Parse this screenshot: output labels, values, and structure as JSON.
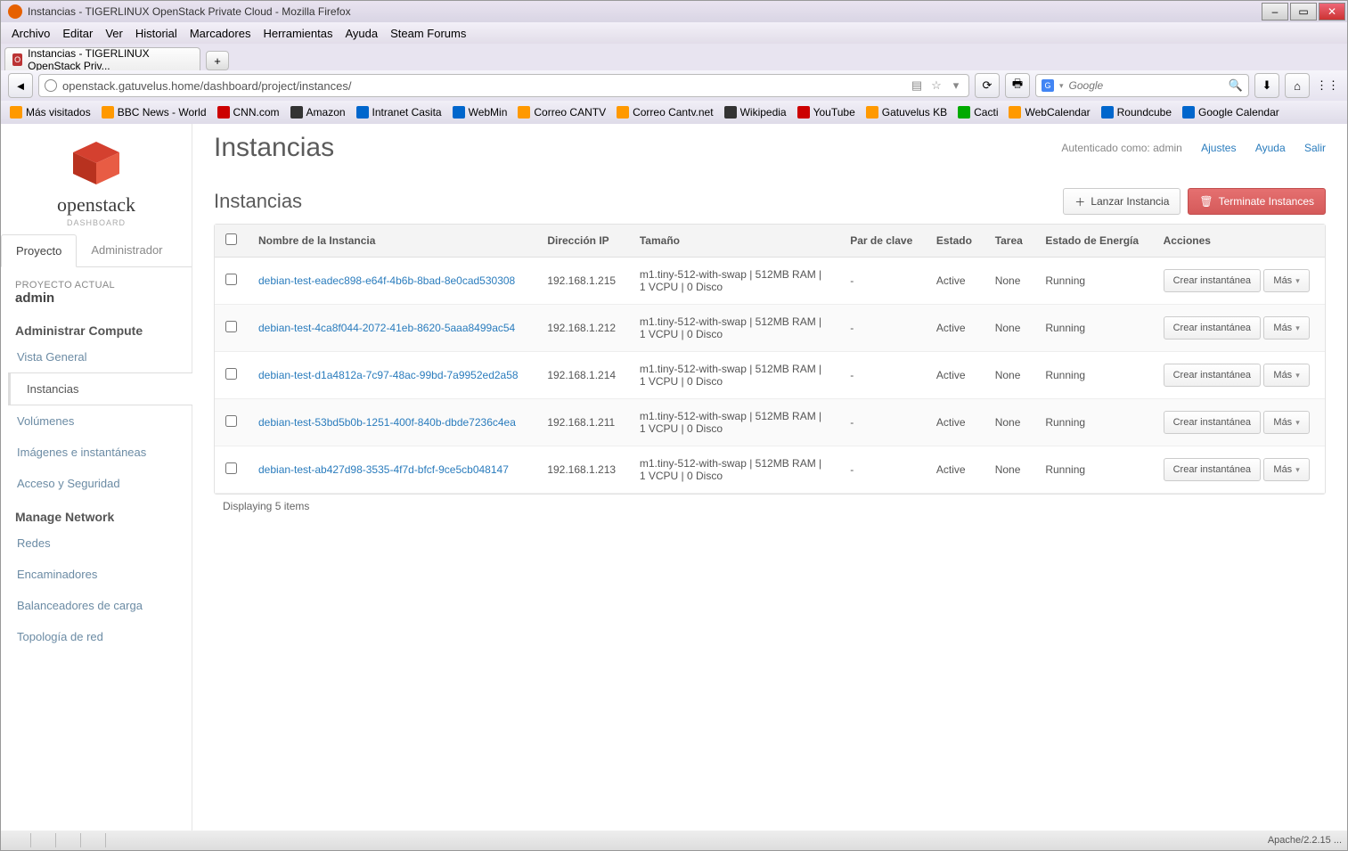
{
  "window": {
    "title": "Instancias - TIGERLINUX OpenStack Private Cloud - Mozilla Firefox"
  },
  "menubar": [
    "Archivo",
    "Editar",
    "Ver",
    "Historial",
    "Marcadores",
    "Herramientas",
    "Ayuda",
    "Steam Forums"
  ],
  "tab": {
    "label": "Instancias - TIGERLINUX OpenStack Priv..."
  },
  "url": "openstack.gatuvelus.home/dashboard/project/instances/",
  "search": {
    "placeholder": "Google"
  },
  "bookmarks": [
    "Más visitados",
    "BBC News - World",
    "CNN.com",
    "Amazon",
    "Intranet Casita",
    "WebMin",
    "Correo CANTV",
    "Correo Cantv.net",
    "Wikipedia",
    "YouTube",
    "Gatuvelus KB",
    "Cacti",
    "WebCalendar",
    "Roundcube",
    "Google Calendar"
  ],
  "logo": {
    "name": "openstack",
    "sub": "DASHBOARD"
  },
  "sidetabs": {
    "project": "Proyecto",
    "admin": "Administrador"
  },
  "project": {
    "label": "PROYECTO ACTUAL",
    "value": "admin"
  },
  "nav": {
    "compute_hdr": "Administrar Compute",
    "compute": [
      "Vista General",
      "Instancias",
      "Volúmenes",
      "Imágenes e instantáneas",
      "Acceso y Seguridad"
    ],
    "network_hdr": "Manage Network",
    "network": [
      "Redes",
      "Encaminadores",
      "Balanceadores de carga",
      "Topología de red"
    ]
  },
  "page": {
    "title": "Instancias",
    "auth_prefix": "Autenticado como: ",
    "auth_user": "admin",
    "link_settings": "Ajustes",
    "link_help": "Ayuda",
    "link_logout": "Salir",
    "subtitle": "Instancias",
    "btn_launch": "Lanzar Instancia",
    "btn_terminate": "Terminate Instances"
  },
  "table": {
    "headers": [
      "Nombre de la Instancia",
      "Dirección IP",
      "Tamaño",
      "Par de clave",
      "Estado",
      "Tarea",
      "Estado de Energía",
      "Acciones"
    ],
    "rows": [
      {
        "name": "debian-test-eadec898-e64f-4b6b-8bad-8e0cad530308",
        "ip": "192.168.1.215",
        "size": "m1.tiny-512-with-swap | 512MB RAM | 1 VCPU | 0 Disco",
        "key": "-",
        "state": "Active",
        "task": "None",
        "power": "Running"
      },
      {
        "name": "debian-test-4ca8f044-2072-41eb-8620-5aaa8499ac54",
        "ip": "192.168.1.212",
        "size": "m1.tiny-512-with-swap | 512MB RAM | 1 VCPU | 0 Disco",
        "key": "-",
        "state": "Active",
        "task": "None",
        "power": "Running"
      },
      {
        "name": "debian-test-d1a4812a-7c97-48ac-99bd-7a9952ed2a58",
        "ip": "192.168.1.214",
        "size": "m1.tiny-512-with-swap | 512MB RAM | 1 VCPU | 0 Disco",
        "key": "-",
        "state": "Active",
        "task": "None",
        "power": "Running"
      },
      {
        "name": "debian-test-53bd5b0b-1251-400f-840b-dbde7236c4ea",
        "ip": "192.168.1.211",
        "size": "m1.tiny-512-with-swap | 512MB RAM | 1 VCPU | 0 Disco",
        "key": "-",
        "state": "Active",
        "task": "None",
        "power": "Running"
      },
      {
        "name": "debian-test-ab427d98-3535-4f7d-bfcf-9ce5cb048147",
        "ip": "192.168.1.213",
        "size": "m1.tiny-512-with-swap | 512MB RAM | 1 VCPU | 0 Disco",
        "key": "-",
        "state": "Active",
        "task": "None",
        "power": "Running"
      }
    ],
    "action_snapshot": "Crear instantánea",
    "action_more": "Más",
    "footer": "Displaying 5 items"
  },
  "statusbar": {
    "right": "Apache/2.2.15 ..."
  }
}
